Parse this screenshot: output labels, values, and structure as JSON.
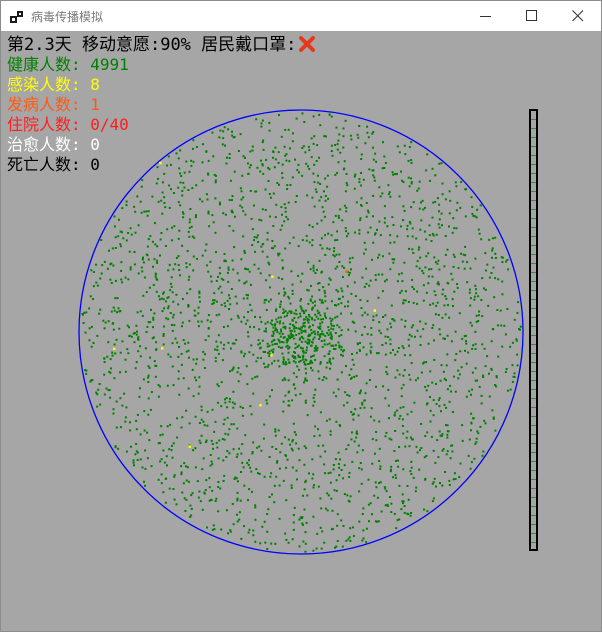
{
  "window": {
    "title": "病毒传播模拟",
    "icons": {
      "app": "app-icon",
      "minimize": "minimize-icon",
      "maximize": "maximize-icon",
      "close": "close-icon"
    }
  },
  "stats": {
    "day_label": "第2.3天",
    "mobility_label": "移动意愿:90%",
    "mask_label": "居民戴口罩:",
    "mask_status_icon": "cross-mark-icon",
    "healthy_label": "健康人数:",
    "healthy_value": "4991",
    "infected_label": "感染人数:",
    "infected_value": "8",
    "sick_label": "发病人数:",
    "sick_value": "1",
    "hospital_label": "住院人数:",
    "hospital_value": "0/40",
    "cured_label": "治愈人数:",
    "cured_value": "0",
    "dead_label": "死亡人数:",
    "dead_value": "0"
  },
  "colors": {
    "background": "#a6a6a6",
    "healthy": "#008000",
    "infected": "#ffff00",
    "sick": "#ff5a14",
    "hospital": "#ff1e1e",
    "cured": "#ffffff",
    "dead": "#000000",
    "boundary": "#0000ff",
    "mask_cross": "#e33a1e"
  }
}
